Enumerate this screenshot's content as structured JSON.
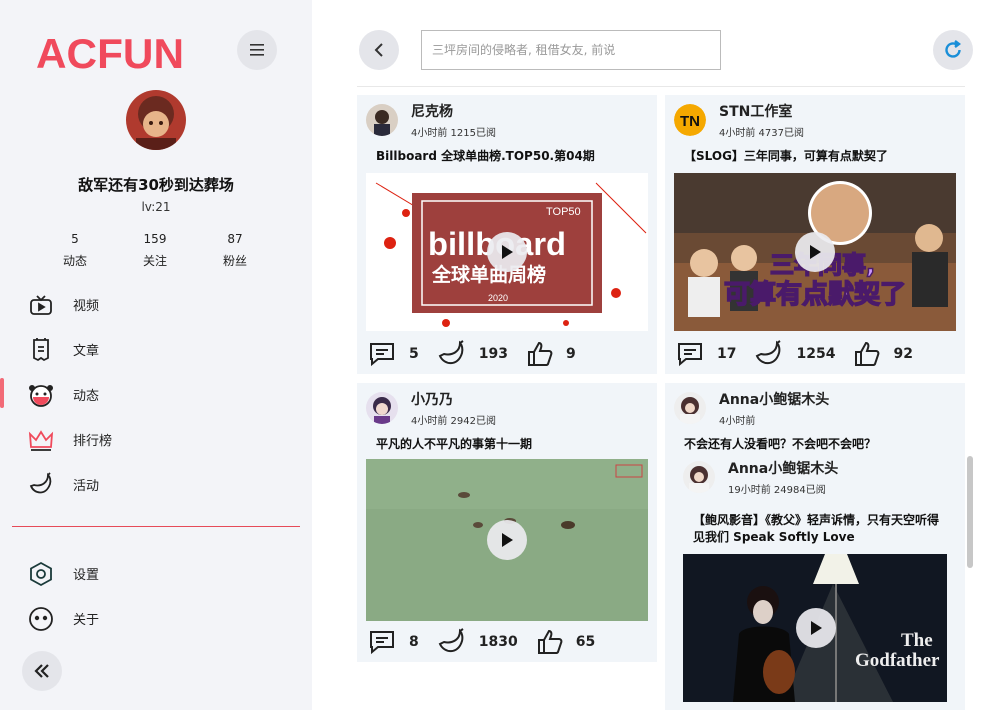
{
  "sidebar": {
    "logo_text": "ACFUN",
    "username": "敌军还有30秒到达葬场",
    "level": "lv:21",
    "stats": [
      {
        "num": "5",
        "label": "动态"
      },
      {
        "num": "159",
        "label": "关注"
      },
      {
        "num": "87",
        "label": "粉丝"
      }
    ],
    "nav": [
      {
        "label": "视频",
        "icon": "video-icon"
      },
      {
        "label": "文章",
        "icon": "article-icon"
      },
      {
        "label": "动态",
        "icon": "dynamic-icon"
      },
      {
        "label": "排行榜",
        "icon": "crown-icon"
      },
      {
        "label": "活动",
        "icon": "banana-icon"
      }
    ],
    "nav2": [
      {
        "label": "设置",
        "icon": "settings-icon"
      },
      {
        "label": "关于",
        "icon": "about-icon"
      }
    ],
    "accent": "#f04a5c"
  },
  "search": {
    "placeholder": "三坪房间的侵略者, 租借女友, 前说"
  },
  "feed": [
    {
      "author": "尼克杨",
      "sub": "4小时前 1215已阅",
      "title": "Billboard 全球单曲榜.TOP50.第04期",
      "comments": "5",
      "bananas": "193",
      "likes": "9"
    },
    {
      "author": "STN工作室",
      "sub": "4小时前 4737已阅",
      "title": "【SLOG】三年同事，可算有点默契了",
      "comments": "17",
      "bananas": "1254",
      "likes": "92"
    },
    {
      "author": "小乃乃",
      "sub": "4小时前 2942已阅",
      "title": "平凡的人不平凡的事第十一期",
      "comments": "8",
      "bananas": "1830",
      "likes": "65"
    },
    {
      "author": "Anna小鲍锯木头",
      "sub": "4小时前",
      "title": "不会还有人没看吧？不会吧不会吧？",
      "repost": {
        "author": "Anna小鲍锯木头",
        "sub": "19小时前 24984已阅",
        "title_line1": "【鲍风影音】《教父》轻声诉情，只有天空听得",
        "title_line2": "见我们 Speak Softly Love"
      }
    }
  ],
  "thumb_text": {
    "billboard": "billboard",
    "billboard_sub": "全球单曲周榜",
    "billboard_top": "TOP50",
    "billboard_year": "2020",
    "stn_overlay_1": "三年同事,",
    "stn_overlay_2": "可算有点默契了",
    "godfather_1": "The",
    "godfather_2": "Godfather"
  }
}
